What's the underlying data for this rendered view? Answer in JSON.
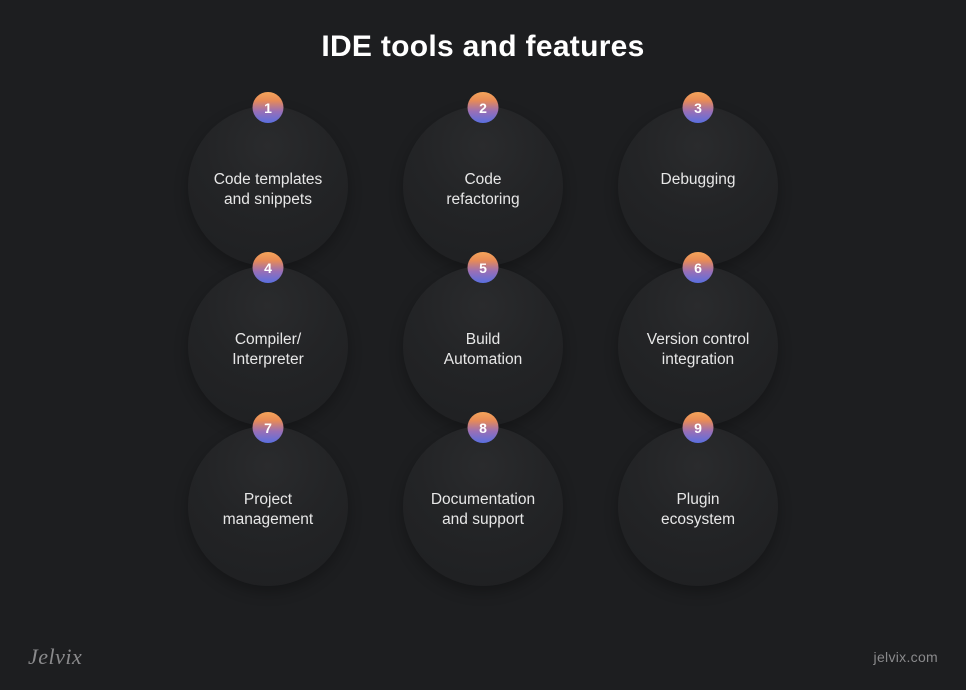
{
  "title": "IDE tools and features",
  "features": [
    {
      "number": "1",
      "label": "Code templates\nand snippets"
    },
    {
      "number": "2",
      "label": "Code\nrefactoring"
    },
    {
      "number": "3",
      "label": "Debugging"
    },
    {
      "number": "4",
      "label": "Compiler/\nInterpreter"
    },
    {
      "number": "5",
      "label": "Build\nAutomation"
    },
    {
      "number": "6",
      "label": "Version control\nintegration"
    },
    {
      "number": "7",
      "label": "Project\nmanagement"
    },
    {
      "number": "8",
      "label": "Documentation\nand support"
    },
    {
      "number": "9",
      "label": "Plugin\necosystem"
    }
  ],
  "footer": {
    "logo": "Jelvix",
    "url": "jelvix.com"
  }
}
